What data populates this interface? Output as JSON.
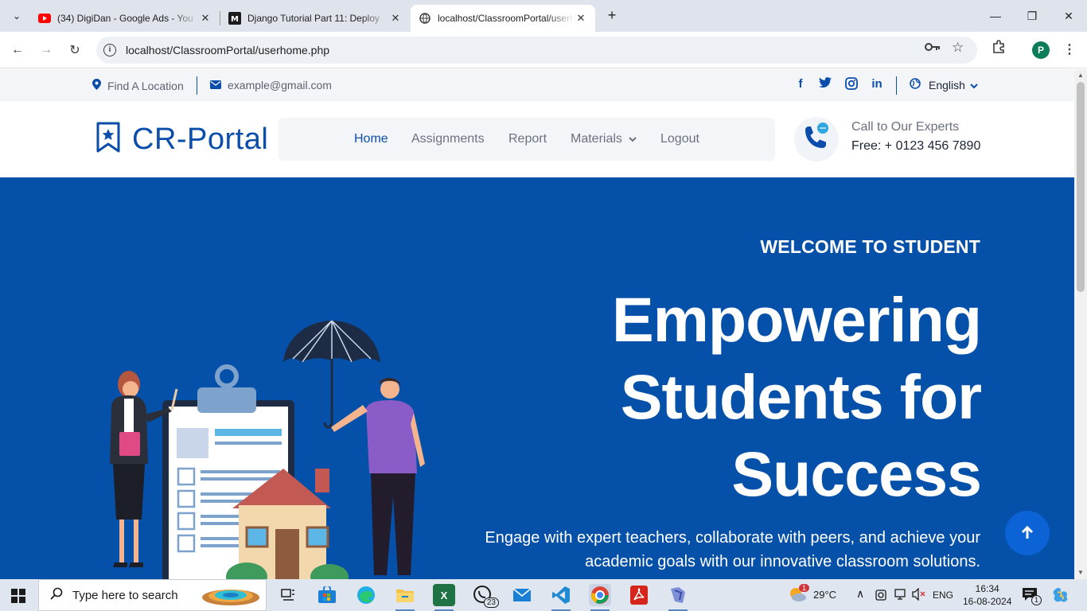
{
  "browser": {
    "tabs": [
      {
        "title": "(34) DigiDan - Google Ads - You",
        "favicon": "youtube-icon",
        "active": false
      },
      {
        "title": "Django Tutorial Part 11: Deploy",
        "favicon": "mdn-icon",
        "active": false
      },
      {
        "title": "localhost/ClassroomPortal/userh",
        "favicon": "globe-icon",
        "active": true
      }
    ],
    "url": "localhost/ClassroomPortal/userhome.php",
    "profile_initial": "P"
  },
  "topbar": {
    "location": "Find A Location",
    "email": "example@gmail.com",
    "social": [
      "facebook-icon",
      "twitter-icon",
      "instagram-icon",
      "linkedin-icon"
    ],
    "language": "English"
  },
  "navbar": {
    "brand": "CR-Portal",
    "menu": [
      {
        "label": "Home",
        "active": true
      },
      {
        "label": "Assignments",
        "active": false
      },
      {
        "label": "Report",
        "active": false
      },
      {
        "label": "Materials",
        "active": false,
        "dropdown": true
      },
      {
        "label": "Logout",
        "active": false
      }
    ],
    "call_label": "Call to Our Experts",
    "call_number": "Free: + 0123 456 7890"
  },
  "hero": {
    "kicker": "WELCOME TO STUDENT",
    "headline": "Empowering Students for Success",
    "subtext": "Engage with expert teachers, collaborate with peers, and achieve your academic goals with our innovative classroom solutions."
  },
  "taskbar": {
    "search_placeholder": "Type here to search",
    "whatsapp_badge": "23",
    "weather": "29°C",
    "weather_badge": "1",
    "input_lang": "ENG",
    "time": "16:34",
    "date": "16-08-2024",
    "notification_count": "1"
  },
  "colors": {
    "brand_blue": "#0b4dab",
    "hero_bg": "#0550a8",
    "backtop_bg": "#0b63d6"
  }
}
